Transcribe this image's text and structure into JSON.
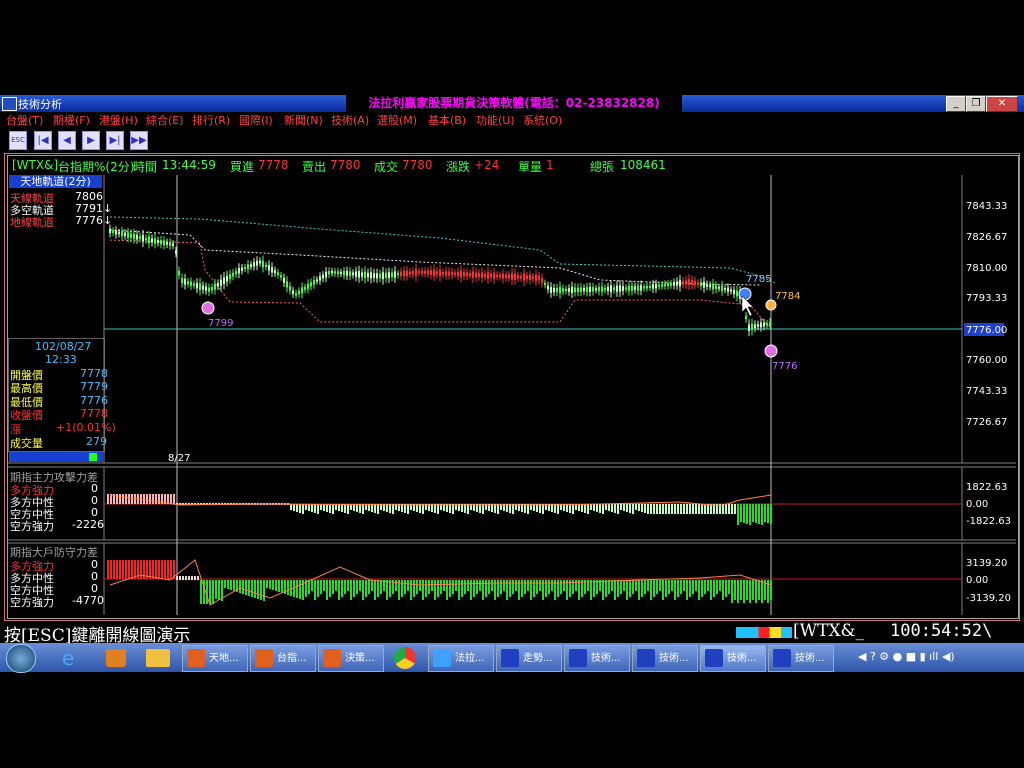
{
  "window": {
    "title": "技術分析",
    "banner": "法拉利贏家股票期貨決策軟體(電話：02-23832828)"
  },
  "menu": [
    "台盤(T)",
    "期權(F)",
    "港盤(H)",
    "綜合(E)",
    "排行(R)",
    "國際(I)",
    "新聞(N)",
    "技術(A)",
    "選股(M)",
    "基本(B)",
    "功能(U)",
    "系統(O)"
  ],
  "toolbar": {
    "esc_label": "ESC"
  },
  "quote": {
    "symbol": "[WTX&]",
    "name": "台指期%(2分)",
    "time_label": "時間",
    "time": "13:44:59",
    "bid_label": "買進",
    "bid": "7778",
    "ask_label": "賣出",
    "ask": "7780",
    "trade_label": "成交",
    "trade": "7780",
    "change_label": "漲跌",
    "change": "+24",
    "volume_label": "單量",
    "volume": "1",
    "total_label": "總張",
    "total": "108461"
  },
  "indicator_panel": {
    "title": "天地軌道(2分)",
    "rows": [
      {
        "label": "天線軌道",
        "value": "7806"
      },
      {
        "label": "多空軌道",
        "value": "7791↓"
      },
      {
        "label": "地線軌道",
        "value": "7776↓"
      }
    ]
  },
  "info_panel": {
    "date": "102/08/27",
    "time": "12:33",
    "rows": [
      {
        "label": "開盤價",
        "value": "7778",
        "color": "#40c0ff"
      },
      {
        "label": "最高價",
        "value": "7779",
        "color": "#40c0ff"
      },
      {
        "label": "最低價",
        "value": "7776",
        "color": "#40c0ff"
      },
      {
        "label": "收盤價",
        "value": "7778",
        "color": "#ff3030"
      },
      {
        "label": "漲",
        "value": "+1(0.01%)",
        "color": "#ff3030"
      },
      {
        "label": "成交量",
        "value": "279",
        "color": "#40c0ff"
      }
    ]
  },
  "chart": {
    "y_labels": [
      "7843.33",
      "7826.67",
      "7810.00",
      "7793.33",
      "7776.00",
      "7760.00",
      "7743.33",
      "7726.67"
    ],
    "current_price": "7776.00",
    "date_label": "8/27",
    "annotations": {
      "low": "7799",
      "cursor": "7785",
      "right_high": "7784",
      "right_low": "7776"
    }
  },
  "panel2": {
    "title": "期指主力攻擊力差",
    "rows": [
      {
        "label": "多方強力",
        "value": "0",
        "color": "#ff3030"
      },
      {
        "label": "多方中性",
        "value": "0",
        "color": "#ffffff"
      },
      {
        "label": "空方中性",
        "value": "0",
        "color": "#ffffff"
      },
      {
        "label": "空方強力",
        "value": "-2226",
        "color": "#ffffff"
      }
    ],
    "y_labels": [
      "1822.63",
      "0.00",
      "-1822.63"
    ]
  },
  "panel3": {
    "title": "期指大戶防守力差",
    "rows": [
      {
        "label": "多方強力",
        "value": "0",
        "color": "#ff3030"
      },
      {
        "label": "多方中性",
        "value": "0",
        "color": "#ffffff"
      },
      {
        "label": "空方中性",
        "value": "0",
        "color": "#ffffff"
      },
      {
        "label": "空方強力",
        "value": "-4770",
        "color": "#ffffff"
      }
    ],
    "y_labels": [
      "3139.20",
      "0.00",
      "-3139.20"
    ]
  },
  "status": {
    "hint": "按[ESC]鍵離開線圖演示",
    "symbol": "[WTX&_",
    "clock": "100:54:52\\"
  },
  "taskbar": {
    "items": [
      "天地...",
      "台指...",
      "決策...",
      "法拉...",
      "走勢...",
      "技術...",
      "技術...",
      "技術...",
      "技術..."
    ]
  }
}
